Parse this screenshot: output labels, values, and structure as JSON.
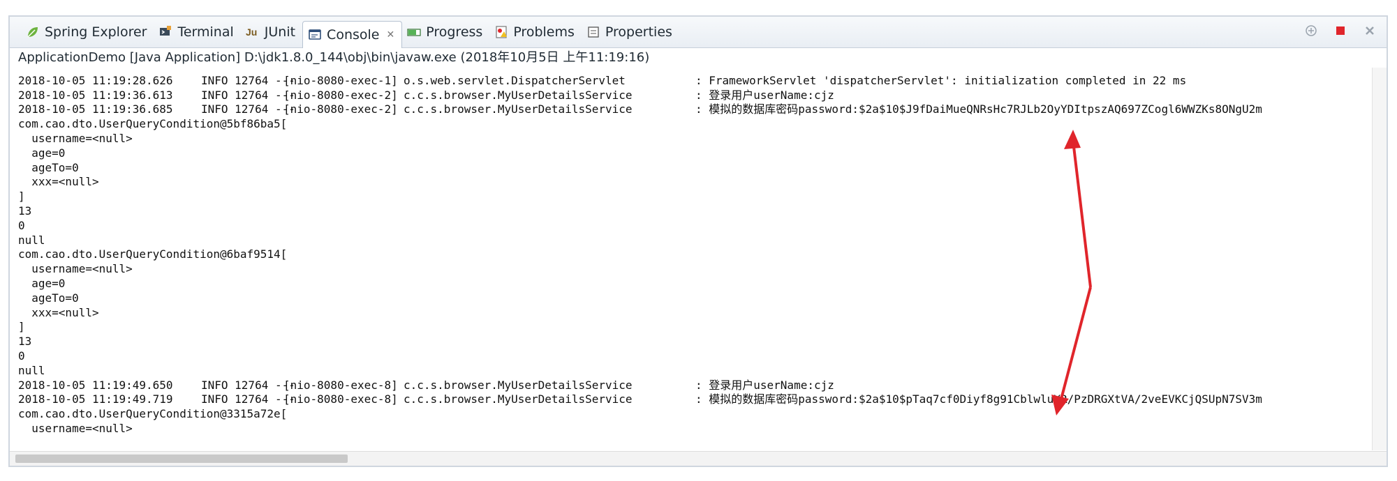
{
  "tabs": [
    {
      "label": "Spring Explorer",
      "icon": "spring-leaf-icon"
    },
    {
      "label": "Terminal",
      "icon": "terminal-icon"
    },
    {
      "label": "JUnit",
      "icon": "junit-icon"
    },
    {
      "label": "Console",
      "icon": "console-icon",
      "active": true,
      "close_glyph": "✕"
    },
    {
      "label": "Progress",
      "icon": "progress-icon"
    },
    {
      "label": "Problems",
      "icon": "problems-icon"
    },
    {
      "label": "Properties",
      "icon": "properties-icon"
    }
  ],
  "path_label": "ApplicationDemo [Java Application] D:\\jdk1.8.0_144\\obj\\bin\\javaw.exe (2018年10月5日 上午11:19:16)",
  "colors": {
    "accent_stop": "#e0252b",
    "arrow": "#e0252b"
  },
  "console": {
    "log_rows_top": [
      {
        "ts": "2018-10-05 11:19:28.626",
        "info": "INFO 12764 ---",
        "thread": "[nio-8080-exec-1]",
        "logger": "o.s.web.servlet.DispatcherServlet",
        "msg": ": FrameworkServlet 'dispatcherServlet': initialization completed in 22 ms"
      },
      {
        "ts": "2018-10-05 11:19:36.613",
        "info": "INFO 12764 ---",
        "thread": "[nio-8080-exec-2]",
        "logger": "c.c.s.browser.MyUserDetailsService",
        "msg": ": 登录用户userName:cjz"
      },
      {
        "ts": "2018-10-05 11:19:36.685",
        "info": "INFO 12764 ---",
        "thread": "[nio-8080-exec-2]",
        "logger": "c.c.s.browser.MyUserDetailsService",
        "msg": ": 模拟的数据库密码password:$2a$10$J9fDaiMueQNRsHc7RJLb2OyYDItpszAQ697ZCogl6WWZKs8ONgU2m"
      }
    ],
    "block1": [
      "com.cao.dto.UserQueryCondition@5bf86ba5[",
      "  username=<null>",
      "  age=0",
      "  ageTo=0",
      "  xxx=<null>",
      "]",
      "13",
      "0",
      "null"
    ],
    "block2": [
      "com.cao.dto.UserQueryCondition@6baf9514[",
      "  username=<null>",
      "  age=0",
      "  ageTo=0",
      "  xxx=<null>",
      "]",
      "13",
      "0",
      "null"
    ],
    "log_rows_bottom": [
      {
        "ts": "2018-10-05 11:19:49.650",
        "info": "INFO 12764 ---",
        "thread": "[nio-8080-exec-8]",
        "logger": "c.c.s.browser.MyUserDetailsService",
        "msg": ": 登录用户userName:cjz"
      },
      {
        "ts": "2018-10-05 11:19:49.719",
        "info": "INFO 12764 ---",
        "thread": "[nio-8080-exec-8]",
        "logger": "c.c.s.browser.MyUserDetailsService",
        "msg": ": 模拟的数据库密码password:$2a$10$pTaq7cf0Diyf8g91CblwluYR/PzDRGXtVA/2veEVKCjQSUpN7SV3m"
      }
    ],
    "tail": [
      "com.cao.dto.UserQueryCondition@3315a72e[",
      "  username=<null>"
    ]
  }
}
